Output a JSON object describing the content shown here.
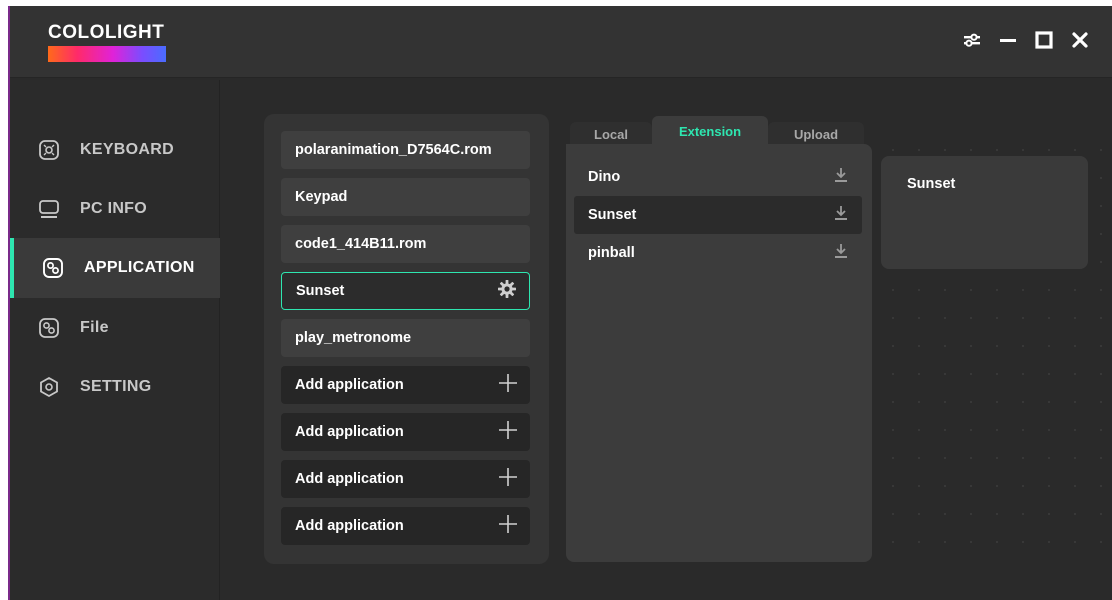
{
  "app": {
    "logo_text": "COLOLIGHT"
  },
  "window_controls": {
    "icons": [
      "sliders-icon",
      "minimize-icon",
      "maximize-icon",
      "close-icon"
    ]
  },
  "sidebar": {
    "items": [
      {
        "label": "KEYBOARD",
        "icon": "keyboard-icon",
        "active": false
      },
      {
        "label": "PC INFO",
        "icon": "monitor-icon",
        "active": false
      },
      {
        "label": "APPLICATION",
        "icon": "application-icon",
        "active": true
      },
      {
        "label": "File",
        "icon": "file-icon",
        "active": false
      },
      {
        "label": "SETTING",
        "icon": "hexagon-icon",
        "active": false
      }
    ]
  },
  "apps": {
    "items": [
      {
        "label": "polaranimation_D7564C.rom",
        "state": "normal"
      },
      {
        "label": "Keypad",
        "state": "normal"
      },
      {
        "label": "code1_414B11.rom",
        "state": "normal"
      },
      {
        "label": "Sunset",
        "state": "selected"
      },
      {
        "label": "play_metronome",
        "state": "normal"
      },
      {
        "label": "Add application",
        "state": "empty"
      },
      {
        "label": "Add application",
        "state": "empty"
      },
      {
        "label": "Add application",
        "state": "empty"
      },
      {
        "label": "Add application",
        "state": "empty"
      }
    ]
  },
  "library": {
    "tabs": [
      {
        "label": "Local",
        "active": false
      },
      {
        "label": "Extension",
        "active": true
      },
      {
        "label": "Upload",
        "active": false
      }
    ],
    "items": [
      {
        "label": "Dino",
        "selected": false
      },
      {
        "label": "Sunset",
        "selected": true
      },
      {
        "label": "pinball",
        "selected": false
      }
    ]
  },
  "preview": {
    "title": "Sunset"
  },
  "colors": {
    "accent": "#2ee6b0",
    "background": "#2a2a2a",
    "panel": "#343434"
  }
}
